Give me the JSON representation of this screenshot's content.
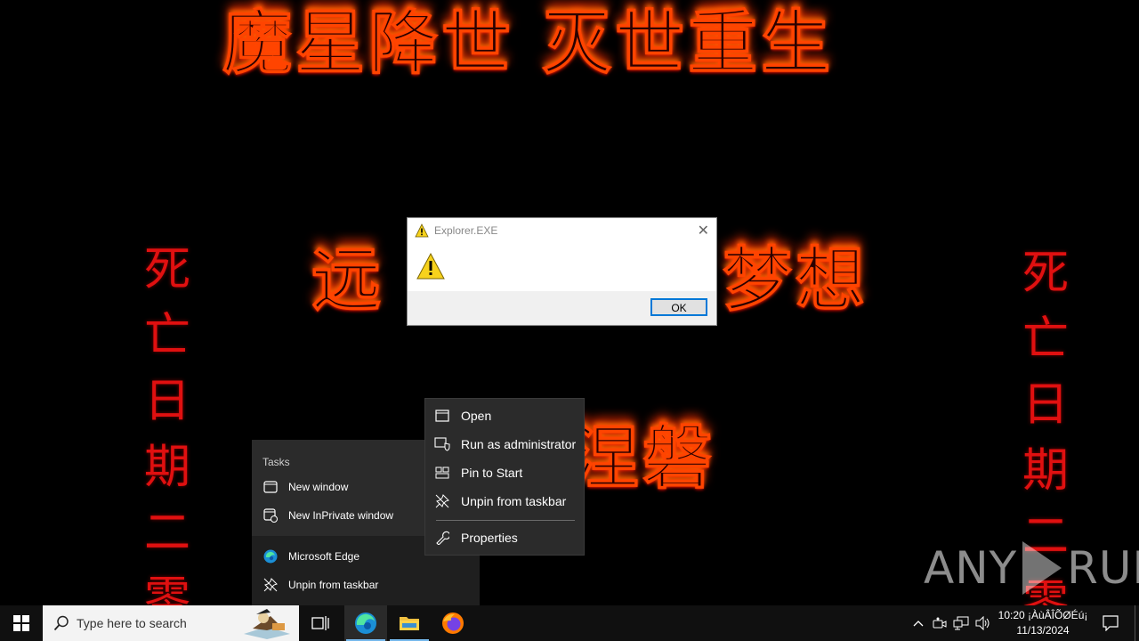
{
  "wallpaper": {
    "top_text": "魔星降世 灭世重生",
    "mid_left": "远",
    "mid_right": "梦想",
    "low_text": "涅磐",
    "column_left": [
      "死",
      "亡",
      "日",
      "期",
      "二",
      "零"
    ],
    "column_right": [
      "死",
      "亡",
      "日",
      "期",
      "二",
      "零"
    ]
  },
  "watermark": {
    "left": "ANY",
    "right": "RUN"
  },
  "msgbox": {
    "title": "Explorer.EXE",
    "close_glyph": "✕",
    "ok_label": "OK"
  },
  "jumplist": {
    "section": "Tasks",
    "tasks": [
      {
        "label": "New window",
        "icon": "window-icon"
      },
      {
        "label": "New InPrivate window",
        "icon": "inprivate-icon"
      }
    ],
    "app": {
      "label": "Microsoft Edge",
      "icon": "edge-icon"
    },
    "unpin": {
      "label": "Unpin from taskbar",
      "icon": "unpin-icon"
    }
  },
  "context_menu": {
    "items": [
      {
        "label": "Open",
        "icon": "window-icon"
      },
      {
        "label": "Run as administrator",
        "icon": "shield-icon"
      },
      {
        "label": "Pin to Start",
        "icon": "pin-start-icon"
      },
      {
        "label": "Unpin from taskbar",
        "icon": "unpin-icon"
      },
      {
        "label": "Properties",
        "icon": "wrench-icon"
      }
    ]
  },
  "taskbar": {
    "search_placeholder": "Type here to search",
    "clock_time": "10:20 ¡ÀùÂÎÕØÉú¡",
    "clock_date": "11/13/2024",
    "accent": "#76b9ed"
  }
}
